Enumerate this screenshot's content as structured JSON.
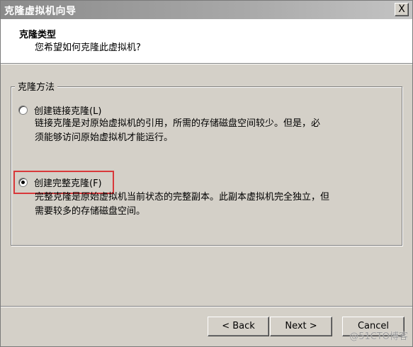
{
  "window": {
    "title": "克隆虚拟机向导",
    "close_glyph": "X"
  },
  "header": {
    "title": "克隆类型",
    "subtitle": "您希望如何克隆此虚拟机?"
  },
  "group": {
    "legend": "克隆方法"
  },
  "options": [
    {
      "label": "创建链接克隆(L)",
      "selected": false,
      "desc_line1": "链接克隆是对原始虚拟机的引用，所需的存储磁盘空间较少。但是，必",
      "desc_line2": "须能够访问原始虚拟机才能运行。"
    },
    {
      "label": "创建完整克隆(F)",
      "selected": true,
      "desc_line1": "完整克隆是原始虚拟机当前状态的完整副本。此副本虚拟机完全独立，但",
      "desc_line2": "需要较多的存储磁盘空间。"
    }
  ],
  "buttons": {
    "back": "< Back",
    "next": "Next >",
    "cancel": "Cancel"
  },
  "watermark": "@51CTO博客",
  "colors": {
    "highlight_box": "#d9383a",
    "dialog_bg": "#d4d0c8",
    "header_bg": "#ffffff"
  }
}
